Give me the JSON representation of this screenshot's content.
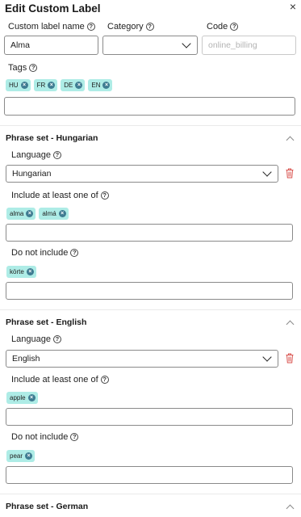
{
  "dialog": {
    "title": "Edit Custom Label",
    "close": "×"
  },
  "fields": {
    "name_label": "Custom label name",
    "name_value": "Alma",
    "category_label": "Category",
    "category_value": "",
    "code_label": "Code",
    "code_placeholder": "online_billing",
    "tags_label": "Tags",
    "tags": [
      "HU",
      "FR",
      "DE",
      "EN"
    ],
    "tags_input_value": ""
  },
  "sections": [
    {
      "title": "Phrase set - Hungarian",
      "language_label": "Language",
      "language_value": "Hungarian",
      "include_label": "Include at least one of",
      "include_tags": [
        "alma",
        "almá"
      ],
      "exclude_label": "Do not include",
      "exclude_tags": [
        "körte"
      ]
    },
    {
      "title": "Phrase set - English",
      "language_label": "Language",
      "language_value": "English",
      "include_label": "Include at least one of",
      "include_tags": [
        "apple"
      ],
      "exclude_label": "Do not include",
      "exclude_tags": [
        "pear"
      ]
    },
    {
      "title": "Phrase set - German"
    }
  ],
  "icons": {
    "help": "?",
    "tag_remove": "×"
  },
  "colors": {
    "tag_bg": "#aeece6",
    "tag_remove_bg": "#3f7c92",
    "trash": "#d9534f"
  }
}
